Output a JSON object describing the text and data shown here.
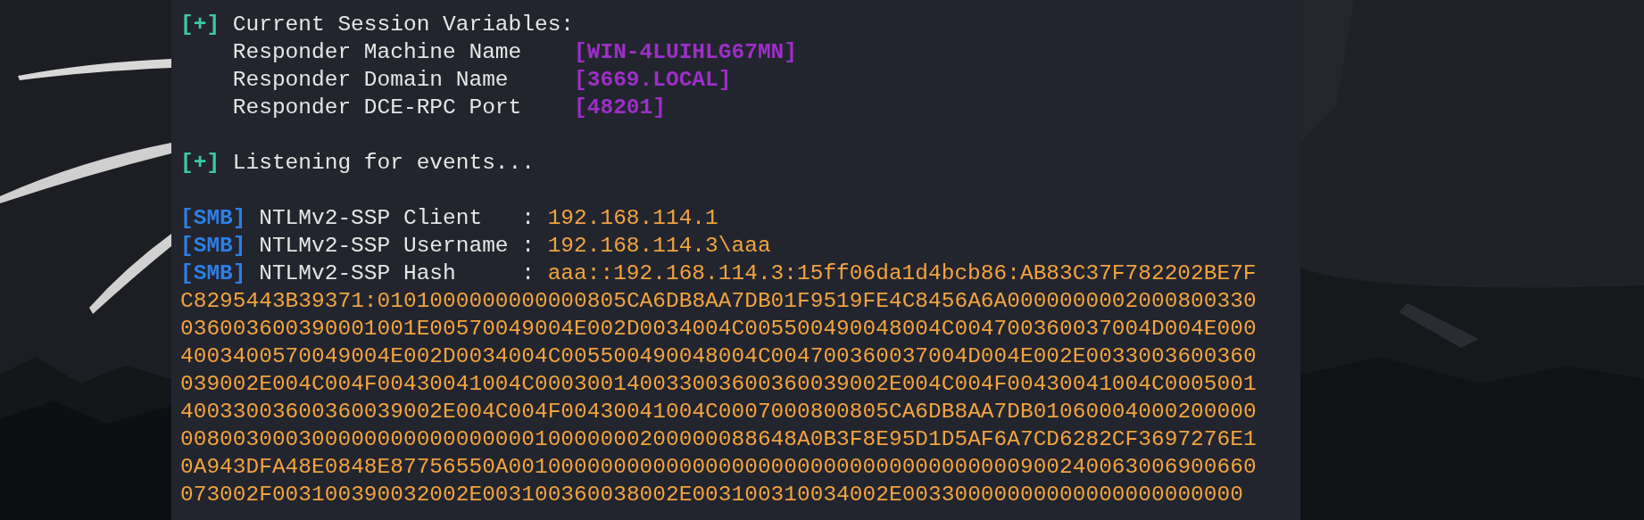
{
  "terminal": {
    "session": {
      "marker": "[+]",
      "title": "Current Session Variables:",
      "variables": [
        {
          "name": "Responder Machine Name",
          "value": "[WIN-4LUIHLG67MN]"
        },
        {
          "name": "Responder Domain Name",
          "value": "[3669.LOCAL]"
        },
        {
          "name": "Responder DCE-RPC Port",
          "value": "[48201]"
        }
      ]
    },
    "status": {
      "marker": "[+]",
      "text": "Listening for events..."
    },
    "events": [
      {
        "tag": "[SMB]",
        "label": "NTLMv2-SSP Client",
        "separator": ":",
        "value": "192.168.114.1"
      },
      {
        "tag": "[SMB]",
        "label": "NTLMv2-SSP Username",
        "separator": ":",
        "value": "192.168.114.3\\aaa"
      },
      {
        "tag": "[SMB]",
        "label": "NTLMv2-SSP Hash",
        "separator": ":",
        "value": "aaa::192.168.114.3:15ff06da1d4bcb86:AB83C37F782202BE7F",
        "continuation": [
          "C8295443B39371:0101000000000000805CA6DB8AA7DB01F9519FE4C8456A6A0000000002000800330",
          "036003600390001001E00570049004E002D0034004C005500490048004C004700360037004D004E000",
          "4003400570049004E002D0034004C005500490048004C004700360037004D004E002E0033003600360",
          "039002E004C004F00430041004C000300140033003600360039002E004C004F00430041004C0005001",
          "40033003600360039002E004C004F00430041004C0007000800805CA6DB8AA7DB01060004000200000",
          "00800300030000000000000000010000000200000088648A0B3F8E95D1D5AF6A7CD6282CF3697276E1",
          "0A943DFA48E0848E87756550A001000000000000000000000000000000000000900240063006900660",
          "073002F003100390032002E003100360038002E003100310034002E00330000000000000000000000"
        ]
      }
    ]
  }
}
